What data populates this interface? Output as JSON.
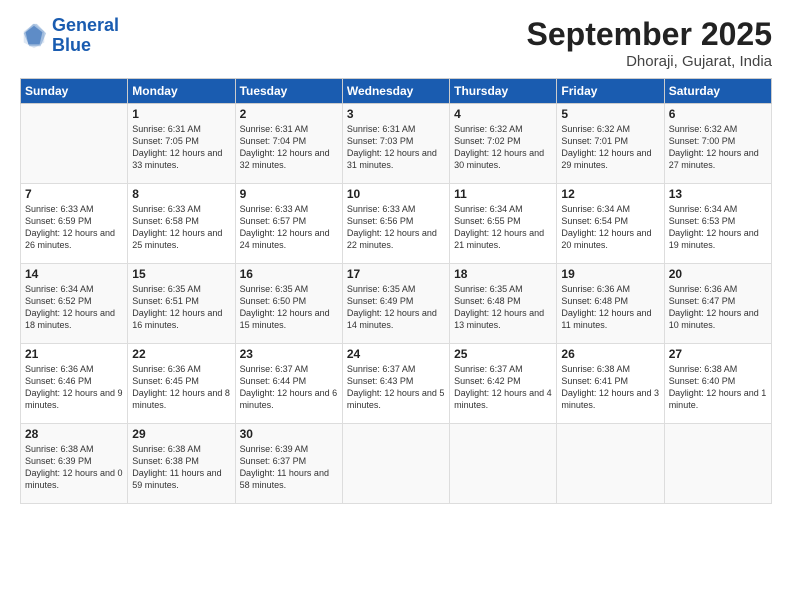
{
  "header": {
    "logo_line1": "General",
    "logo_line2": "Blue",
    "month": "September 2025",
    "location": "Dhoraji, Gujarat, India"
  },
  "days_of_week": [
    "Sunday",
    "Monday",
    "Tuesday",
    "Wednesday",
    "Thursday",
    "Friday",
    "Saturday"
  ],
  "weeks": [
    [
      {
        "day": "",
        "sunrise": "",
        "sunset": "",
        "daylight": ""
      },
      {
        "day": "1",
        "sunrise": "Sunrise: 6:31 AM",
        "sunset": "Sunset: 7:05 PM",
        "daylight": "Daylight: 12 hours and 33 minutes."
      },
      {
        "day": "2",
        "sunrise": "Sunrise: 6:31 AM",
        "sunset": "Sunset: 7:04 PM",
        "daylight": "Daylight: 12 hours and 32 minutes."
      },
      {
        "day": "3",
        "sunrise": "Sunrise: 6:31 AM",
        "sunset": "Sunset: 7:03 PM",
        "daylight": "Daylight: 12 hours and 31 minutes."
      },
      {
        "day": "4",
        "sunrise": "Sunrise: 6:32 AM",
        "sunset": "Sunset: 7:02 PM",
        "daylight": "Daylight: 12 hours and 30 minutes."
      },
      {
        "day": "5",
        "sunrise": "Sunrise: 6:32 AM",
        "sunset": "Sunset: 7:01 PM",
        "daylight": "Daylight: 12 hours and 29 minutes."
      },
      {
        "day": "6",
        "sunrise": "Sunrise: 6:32 AM",
        "sunset": "Sunset: 7:00 PM",
        "daylight": "Daylight: 12 hours and 27 minutes."
      }
    ],
    [
      {
        "day": "7",
        "sunrise": "Sunrise: 6:33 AM",
        "sunset": "Sunset: 6:59 PM",
        "daylight": "Daylight: 12 hours and 26 minutes."
      },
      {
        "day": "8",
        "sunrise": "Sunrise: 6:33 AM",
        "sunset": "Sunset: 6:58 PM",
        "daylight": "Daylight: 12 hours and 25 minutes."
      },
      {
        "day": "9",
        "sunrise": "Sunrise: 6:33 AM",
        "sunset": "Sunset: 6:57 PM",
        "daylight": "Daylight: 12 hours and 24 minutes."
      },
      {
        "day": "10",
        "sunrise": "Sunrise: 6:33 AM",
        "sunset": "Sunset: 6:56 PM",
        "daylight": "Daylight: 12 hours and 22 minutes."
      },
      {
        "day": "11",
        "sunrise": "Sunrise: 6:34 AM",
        "sunset": "Sunset: 6:55 PM",
        "daylight": "Daylight: 12 hours and 21 minutes."
      },
      {
        "day": "12",
        "sunrise": "Sunrise: 6:34 AM",
        "sunset": "Sunset: 6:54 PM",
        "daylight": "Daylight: 12 hours and 20 minutes."
      },
      {
        "day": "13",
        "sunrise": "Sunrise: 6:34 AM",
        "sunset": "Sunset: 6:53 PM",
        "daylight": "Daylight: 12 hours and 19 minutes."
      }
    ],
    [
      {
        "day": "14",
        "sunrise": "Sunrise: 6:34 AM",
        "sunset": "Sunset: 6:52 PM",
        "daylight": "Daylight: 12 hours and 18 minutes."
      },
      {
        "day": "15",
        "sunrise": "Sunrise: 6:35 AM",
        "sunset": "Sunset: 6:51 PM",
        "daylight": "Daylight: 12 hours and 16 minutes."
      },
      {
        "day": "16",
        "sunrise": "Sunrise: 6:35 AM",
        "sunset": "Sunset: 6:50 PM",
        "daylight": "Daylight: 12 hours and 15 minutes."
      },
      {
        "day": "17",
        "sunrise": "Sunrise: 6:35 AM",
        "sunset": "Sunset: 6:49 PM",
        "daylight": "Daylight: 12 hours and 14 minutes."
      },
      {
        "day": "18",
        "sunrise": "Sunrise: 6:35 AM",
        "sunset": "Sunset: 6:48 PM",
        "daylight": "Daylight: 12 hours and 13 minutes."
      },
      {
        "day": "19",
        "sunrise": "Sunrise: 6:36 AM",
        "sunset": "Sunset: 6:48 PM",
        "daylight": "Daylight: 12 hours and 11 minutes."
      },
      {
        "day": "20",
        "sunrise": "Sunrise: 6:36 AM",
        "sunset": "Sunset: 6:47 PM",
        "daylight": "Daylight: 12 hours and 10 minutes."
      }
    ],
    [
      {
        "day": "21",
        "sunrise": "Sunrise: 6:36 AM",
        "sunset": "Sunset: 6:46 PM",
        "daylight": "Daylight: 12 hours and 9 minutes."
      },
      {
        "day": "22",
        "sunrise": "Sunrise: 6:36 AM",
        "sunset": "Sunset: 6:45 PM",
        "daylight": "Daylight: 12 hours and 8 minutes."
      },
      {
        "day": "23",
        "sunrise": "Sunrise: 6:37 AM",
        "sunset": "Sunset: 6:44 PM",
        "daylight": "Daylight: 12 hours and 6 minutes."
      },
      {
        "day": "24",
        "sunrise": "Sunrise: 6:37 AM",
        "sunset": "Sunset: 6:43 PM",
        "daylight": "Daylight: 12 hours and 5 minutes."
      },
      {
        "day": "25",
        "sunrise": "Sunrise: 6:37 AM",
        "sunset": "Sunset: 6:42 PM",
        "daylight": "Daylight: 12 hours and 4 minutes."
      },
      {
        "day": "26",
        "sunrise": "Sunrise: 6:38 AM",
        "sunset": "Sunset: 6:41 PM",
        "daylight": "Daylight: 12 hours and 3 minutes."
      },
      {
        "day": "27",
        "sunrise": "Sunrise: 6:38 AM",
        "sunset": "Sunset: 6:40 PM",
        "daylight": "Daylight: 12 hours and 1 minute."
      }
    ],
    [
      {
        "day": "28",
        "sunrise": "Sunrise: 6:38 AM",
        "sunset": "Sunset: 6:39 PM",
        "daylight": "Daylight: 12 hours and 0 minutes."
      },
      {
        "day": "29",
        "sunrise": "Sunrise: 6:38 AM",
        "sunset": "Sunset: 6:38 PM",
        "daylight": "Daylight: 11 hours and 59 minutes."
      },
      {
        "day": "30",
        "sunrise": "Sunrise: 6:39 AM",
        "sunset": "Sunset: 6:37 PM",
        "daylight": "Daylight: 11 hours and 58 minutes."
      },
      {
        "day": "",
        "sunrise": "",
        "sunset": "",
        "daylight": ""
      },
      {
        "day": "",
        "sunrise": "",
        "sunset": "",
        "daylight": ""
      },
      {
        "day": "",
        "sunrise": "",
        "sunset": "",
        "daylight": ""
      },
      {
        "day": "",
        "sunrise": "",
        "sunset": "",
        "daylight": ""
      }
    ]
  ]
}
